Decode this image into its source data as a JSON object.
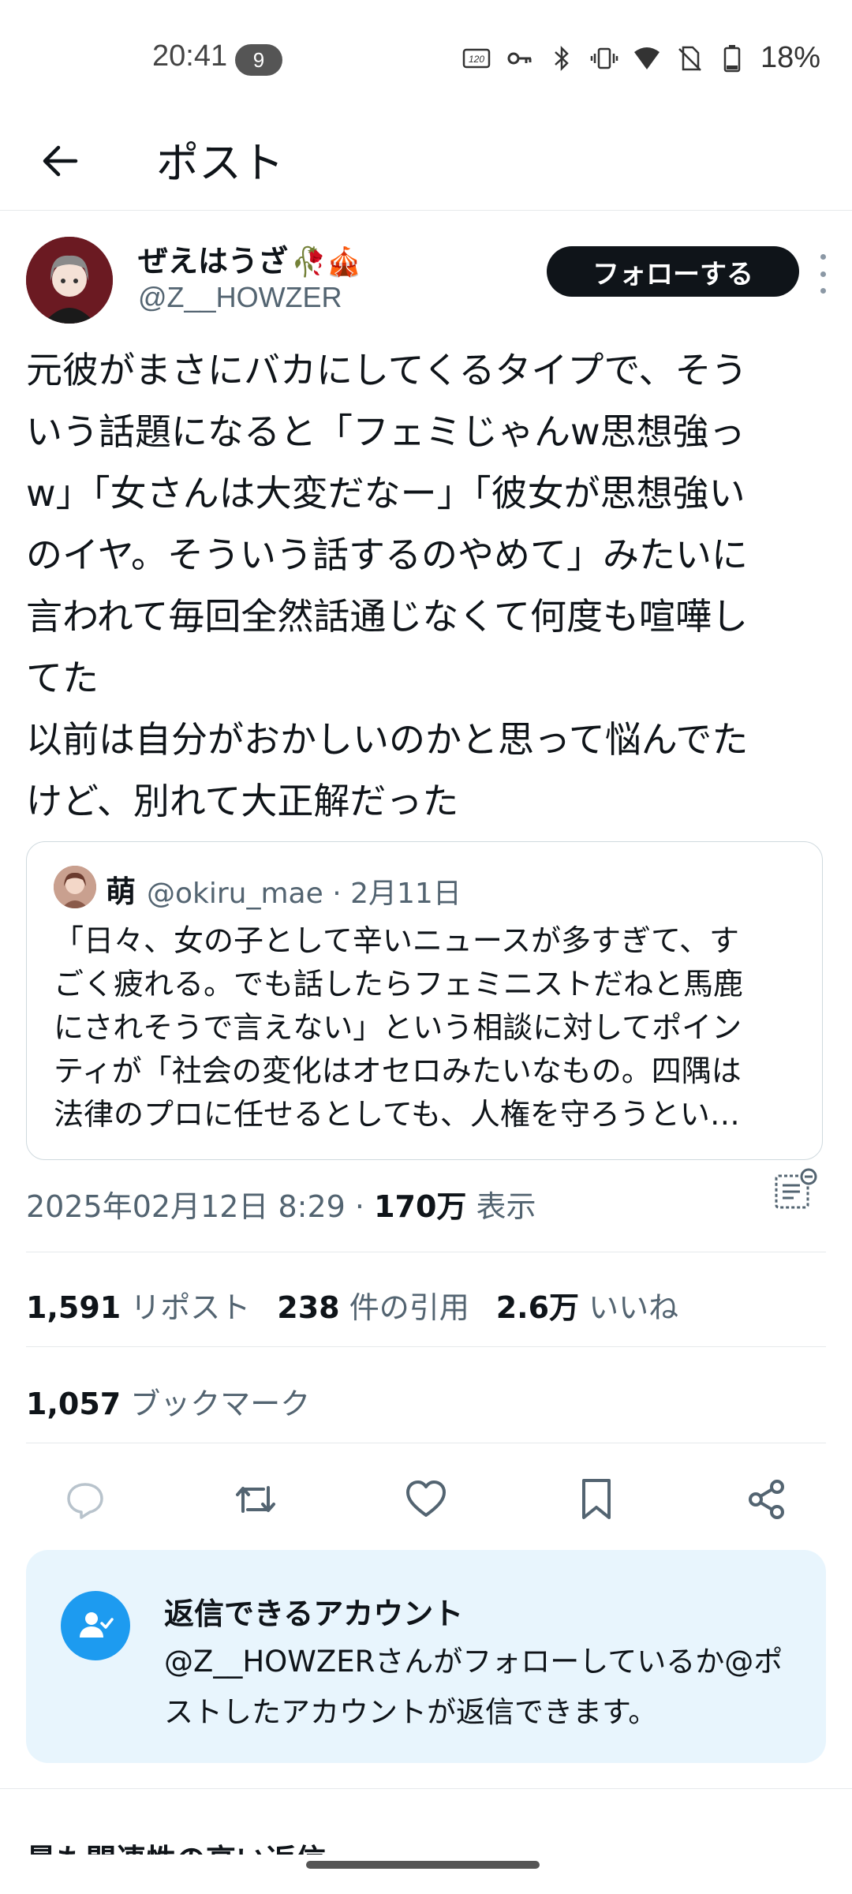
{
  "status_bar": {
    "time": "20:41",
    "notification_count": "9",
    "battery": "18%",
    "refresh_label": "120"
  },
  "header": {
    "title": "ポスト"
  },
  "post": {
    "author_name": "ぜえはうざ",
    "author_emoji": "🥀🎪",
    "author_handle": "@Z__HOWZER",
    "follow_label": "フォローする",
    "text": "元彼がまさにバカにしてくるタイプで、そう\nいう話題になると「フェミじゃんw思想強っ\nw」「女さんは大変だなー」「彼女が思想強い\nのイヤ。そういう話するのやめて」みたいに\n言われて毎回全然話通じなくて何度も喧嘩し\nてた\n以前は自分がおかしいのかと思って悩んでた\nけど、別れて大正解だった",
    "timestamp": "2025年02月12日 8:29 · ",
    "views_count": "170万",
    "views_label": " 表示"
  },
  "quote": {
    "name": "萌",
    "meta": "@okiru_mae · 2月11日",
    "lines": [
      "「日々、女の子として辛いニュースが多すぎて、す",
      "ごく疲れる。でも話したらフェミニストだねと馬鹿",
      "にされそうで言えない」という相談に対してポイン",
      "ティが「社会の変化はオセロみたいなもの。四隅は",
      "法律のプロに任せるとしても、人権を守ろうとい…"
    ]
  },
  "stats": {
    "reposts_count": "1,591",
    "reposts_label": " リポスト",
    "quotes_count": "238",
    "quotes_label": " 件の引用",
    "likes_count": "2.6万",
    "likes_label": " いいね",
    "bookmarks_count": "1,057",
    "bookmarks_label": " ブックマーク"
  },
  "actions": {
    "icons": [
      "reply-icon",
      "repost-icon",
      "like-icon",
      "bookmark-icon",
      "share-icon"
    ]
  },
  "reply_restriction": {
    "title": "返信できるアカウント",
    "description": "@Z__HOWZERさんがフォローしているか@ポストしたアカウントが返信できます。"
  },
  "replies": {
    "sort_label": "最も関連性の高い返信"
  },
  "colors": {
    "accent": "#1d9bf0",
    "text": "#0f1419",
    "secondary": "#536471",
    "reply_box_bg": "#e8f5fd"
  }
}
